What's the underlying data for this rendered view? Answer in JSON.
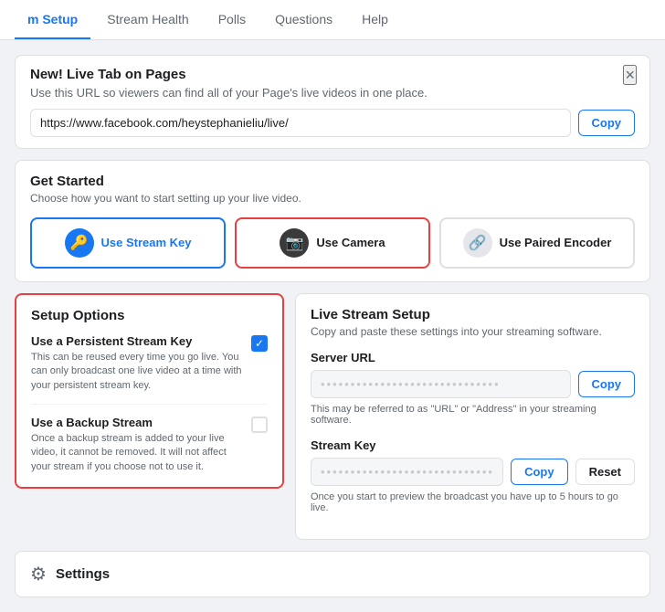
{
  "nav": {
    "tabs": [
      {
        "label": "m Setup",
        "active": true
      },
      {
        "label": "Stream Health",
        "active": false
      },
      {
        "label": "Polls",
        "active": false
      },
      {
        "label": "Questions",
        "active": false
      },
      {
        "label": "Help",
        "active": false
      }
    ]
  },
  "banner": {
    "title": "New! Live Tab on Pages",
    "desc": "Use this URL so viewers can find all of your Page's live videos in one place.",
    "url_value": "https://www.facebook.com/heystephanieliu/live/",
    "copy_label": "Copy",
    "close_label": "×"
  },
  "get_started": {
    "title": "Get Started",
    "desc": "Choose how you want to start setting up your live video.",
    "buttons": [
      {
        "label": "Use Stream Key",
        "icon": "🔑",
        "icon_style": "blue",
        "style": "blue-outline"
      },
      {
        "label": "Use Camera",
        "icon": "📷",
        "icon_style": "dark",
        "style": "red-outline"
      },
      {
        "label": "Use Paired Encoder",
        "icon": "🔗",
        "icon_style": "gray",
        "style": "normal"
      }
    ]
  },
  "setup_options": {
    "title": "Setup Options",
    "options": [
      {
        "title": "Use a Persistent Stream Key",
        "desc": "This can be reused every time you go live. You can only broadcast one live video at a time with your persistent stream key.",
        "checked": true
      },
      {
        "title": "Use a Backup Stream",
        "desc": "Once a backup stream is added to your live video, it cannot be removed. It will not affect your stream if you choose not to use it.",
        "checked": false
      }
    ]
  },
  "live_stream_setup": {
    "title": "Live Stream Setup",
    "desc": "Copy and paste these settings into your streaming software.",
    "server_url_label": "Server URL",
    "server_url_value": "••••••••••••••••••••••••••••••",
    "server_url_hint": "This may be referred to as \"URL\" or \"Address\" in your streaming software.",
    "stream_key_label": "Stream Key",
    "stream_key_value": "••••••••••••••••••••••••••••••",
    "stream_key_hint": "Once you start to preview the broadcast you have up to 5 hours to go live.",
    "copy_label": "Copy",
    "reset_label": "Reset"
  },
  "settings": {
    "label": "Settings"
  },
  "colors": {
    "blue": "#1877f2",
    "red": "#e84040",
    "gray_border": "#dddfe2"
  }
}
